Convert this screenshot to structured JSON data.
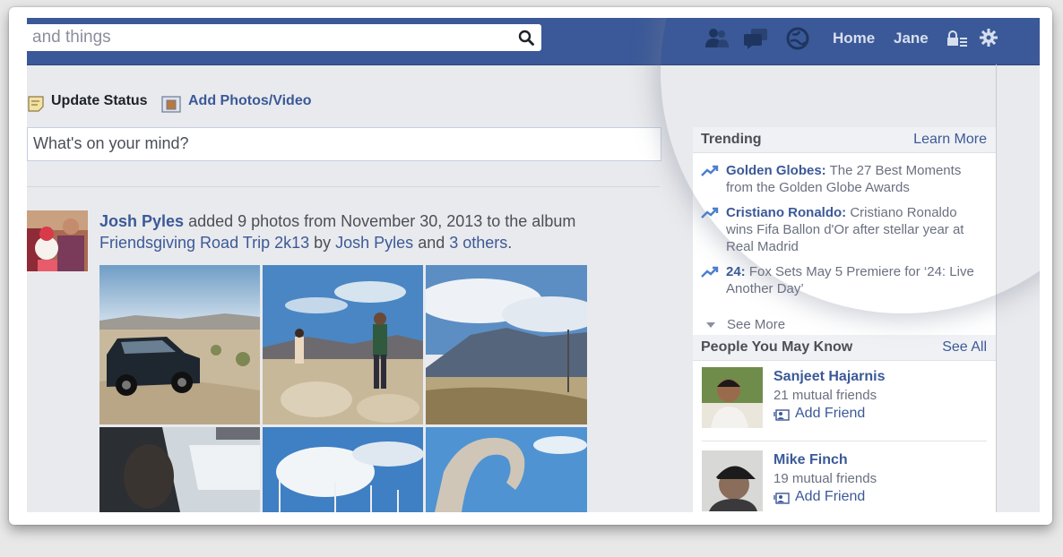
{
  "search": {
    "value": "and things"
  },
  "topbar": {
    "home_label": "Home",
    "user_label": "Jane"
  },
  "composer": {
    "update_status_label": "Update Status",
    "add_photos_label": "Add Photos/Video",
    "placeholder": "What's on your mind?"
  },
  "story": {
    "author": "Josh Pyles",
    "text_1": " added 9 photos from November 30, 2013 to the album ",
    "album": "Friendsgiving Road Trip 2k13",
    "text_2": " by ",
    "author_2": "Josh Pyles",
    "text_3": " and ",
    "others": "3 others",
    "text_4": "."
  },
  "trending": {
    "title": "Trending",
    "learn_more": "Learn More",
    "items": [
      {
        "topic": "Golden Globes:",
        "text": " The 27 Best Moments from the Golden Globe Awards"
      },
      {
        "topic": "Cristiano Ronaldo:",
        "text": " Cristiano Ronaldo wins Fifa Ballon d'Or after stellar year at Real Madrid"
      },
      {
        "topic": "24:",
        "text": " Fox Sets May 5 Premiere for ‘24: Live Another Day’"
      }
    ],
    "see_more": "See More"
  },
  "pymk": {
    "title": "People You May Know",
    "see_all": "See All",
    "people": [
      {
        "name": "Sanjeet Hajarnis",
        "mutual": "21 mutual friends",
        "add": "Add Friend"
      },
      {
        "name": "Mike Finch",
        "mutual": "19 mutual friends",
        "add": "Add Friend"
      }
    ]
  },
  "colors": {
    "brand": "#3b5998",
    "background": "#e9eaed",
    "link": "#3b5998"
  }
}
